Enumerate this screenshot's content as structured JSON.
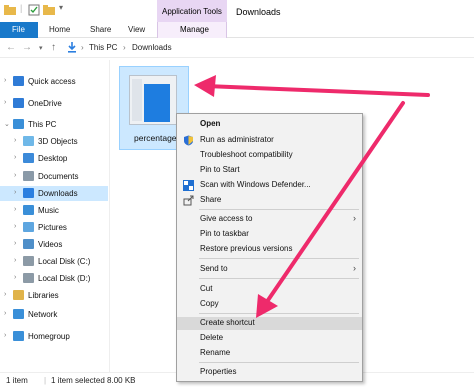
{
  "title_bar": {
    "contextual_group": "Application Tools",
    "window_title": "Downloads"
  },
  "ribbon": {
    "tabs": [
      "File",
      "Home",
      "Share",
      "View",
      "Manage"
    ]
  },
  "address_bar": {
    "breadcrumbs": [
      "This PC",
      "Downloads"
    ]
  },
  "sidebar": {
    "items": [
      {
        "label": "Quick access",
        "icon": "star-icon",
        "color": "#2f7bd6"
      },
      {
        "label": "OneDrive",
        "icon": "cloud-icon",
        "color": "#2f7bd6"
      },
      {
        "label": "This PC",
        "icon": "computer-icon",
        "color": "#3a8fd8"
      },
      {
        "label": "3D Objects",
        "icon": "cube-icon",
        "color": "#6fb8e8"
      },
      {
        "label": "Desktop",
        "icon": "desktop-icon",
        "color": "#3c8ad9"
      },
      {
        "label": "Documents",
        "icon": "document-icon",
        "color": "#8a9aa8"
      },
      {
        "label": "Downloads",
        "icon": "download-icon",
        "color": "#2b7fe0"
      },
      {
        "label": "Music",
        "icon": "music-icon",
        "color": "#3a8fd8"
      },
      {
        "label": "Pictures",
        "icon": "picture-icon",
        "color": "#5ea6e0"
      },
      {
        "label": "Videos",
        "icon": "video-icon",
        "color": "#4f8fc9"
      },
      {
        "label": "Local Disk (C:)",
        "icon": "drive-icon",
        "color": "#8c9aa6"
      },
      {
        "label": "Local Disk (D:)",
        "icon": "drive-icon",
        "color": "#8c9aa6"
      },
      {
        "label": "Libraries",
        "icon": "library-icon",
        "color": "#e0b34a"
      },
      {
        "label": "Network",
        "icon": "network-icon",
        "color": "#3a8fd8"
      },
      {
        "label": "Homegroup",
        "icon": "homegroup-icon",
        "color": "#3a8fd8"
      }
    ]
  },
  "content": {
    "file": {
      "name": "percentage"
    }
  },
  "context_menu": {
    "items": [
      {
        "label": "Open",
        "bold": true
      },
      {
        "label": "Run as administrator",
        "icon": "shield-icon"
      },
      {
        "label": "Troubleshoot compatibility"
      },
      {
        "label": "Pin to Start"
      },
      {
        "label": "Scan with Windows Defender...",
        "icon": "defender-icon"
      },
      {
        "label": "Share",
        "icon": "share-icon"
      },
      {
        "label": "Give access to",
        "submenu": true
      },
      {
        "label": "Pin to taskbar"
      },
      {
        "label": "Restore previous versions"
      },
      {
        "label": "Send to",
        "submenu": true
      },
      {
        "label": "Cut"
      },
      {
        "label": "Copy"
      },
      {
        "label": "Create shortcut",
        "highlighted": true
      },
      {
        "label": "Delete"
      },
      {
        "label": "Rename"
      },
      {
        "label": "Properties"
      }
    ]
  },
  "status_bar": {
    "item_count": "1 item",
    "selection": "1 item selected  8.00 KB"
  },
  "colors": {
    "accent": "#1979ca",
    "selection": "#cce8ff",
    "annotation_arrow": "#ee2a6b"
  }
}
